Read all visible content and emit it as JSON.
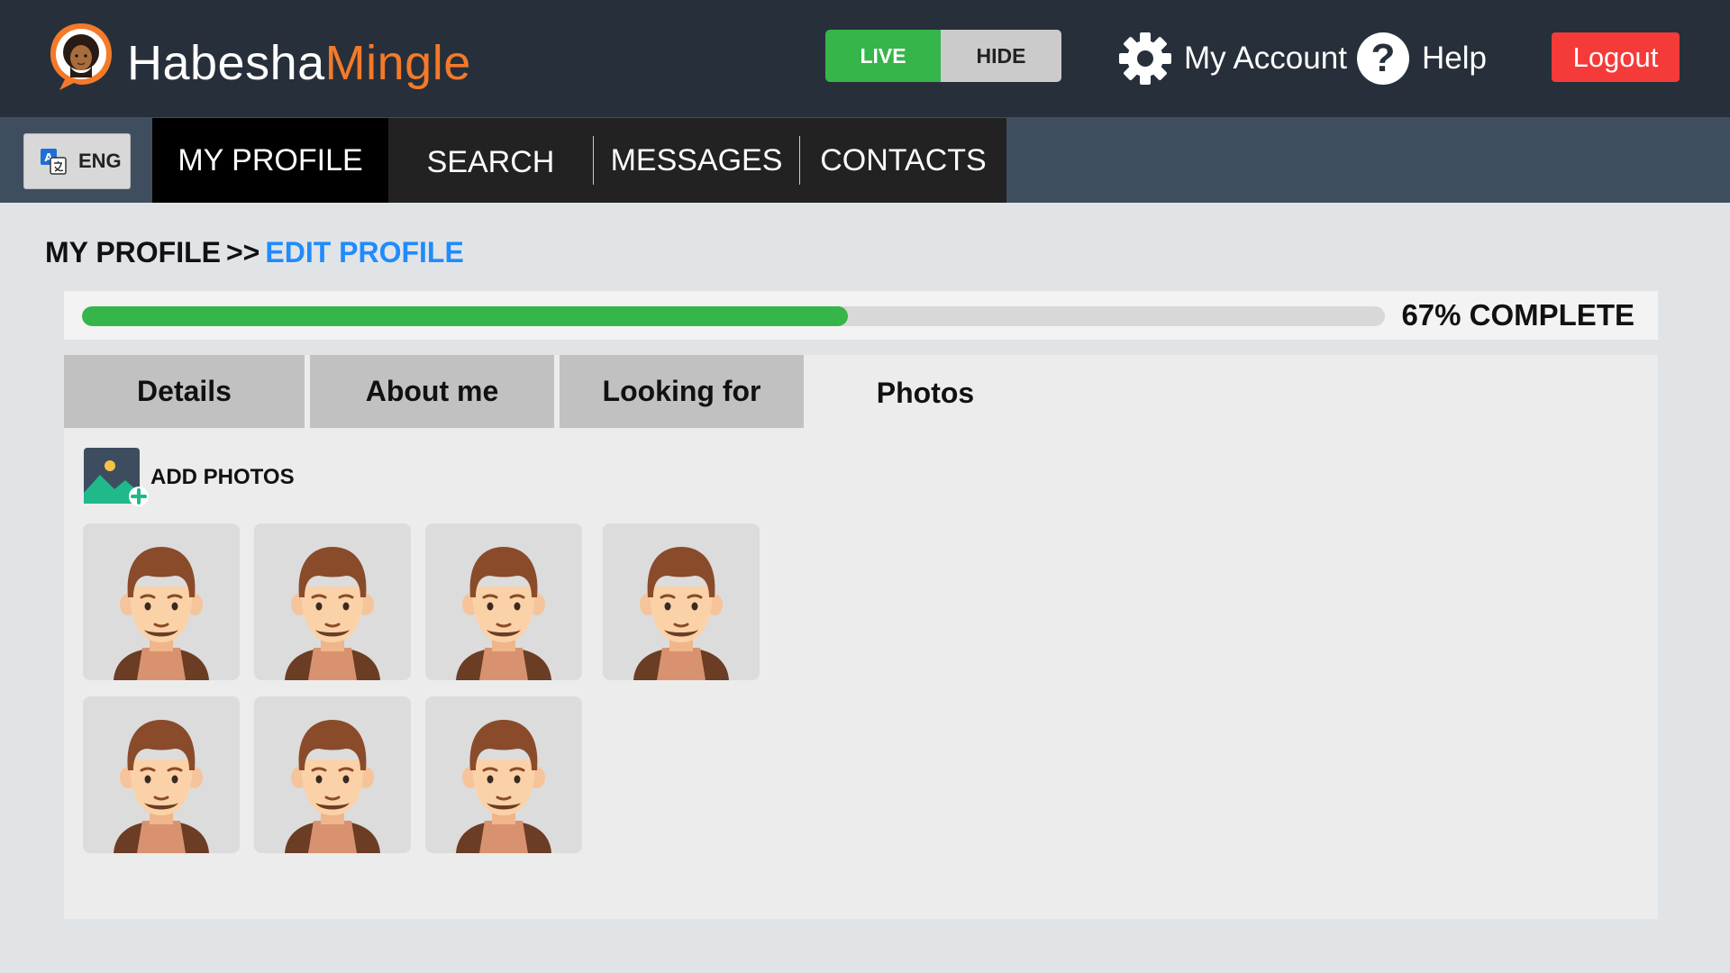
{
  "brand": {
    "name_part1": "Habesha",
    "name_part2": "Mingle",
    "colors": {
      "header": "#27303a",
      "nav": "#3f4e5f",
      "accent": "#f47a2a",
      "green": "#35b54a",
      "red": "#f53a3a",
      "link_blue": "#1f8bff"
    }
  },
  "header": {
    "visibility_toggle": {
      "live_label": "LIVE",
      "hide_label": "HIDE",
      "selected": "LIVE"
    },
    "account_label": "My Account",
    "account_icon": "gear-icon",
    "help_label": "Help",
    "help_icon": "question-circle-icon",
    "logout_label": "Logout"
  },
  "nav": {
    "language_label": "ENG",
    "language_icon": "translate-icon",
    "tabs": [
      {
        "label": "MY PROFILE",
        "active": true
      },
      {
        "label": "SEARCH",
        "active": false
      },
      {
        "label": "MESSAGES",
        "active": false
      },
      {
        "label": "CONTACTS",
        "active": false
      }
    ]
  },
  "breadcrumb": {
    "root": "MY PROFILE",
    "separator": ">>",
    "current": "EDIT PROFILE"
  },
  "progress": {
    "percent": 58.8,
    "label": "67% COMPLETE"
  },
  "edit_tabs": [
    {
      "label": "Details",
      "active": false
    },
    {
      "label": "About me",
      "active": false
    },
    {
      "label": "Looking for",
      "active": false
    },
    {
      "label": "Photos",
      "active": true
    }
  ],
  "photos": {
    "add_label": "ADD PHOTOS",
    "add_icon": "add-photo-icon",
    "count": 7,
    "thumbnail_icon": "male-avatar-icon"
  }
}
